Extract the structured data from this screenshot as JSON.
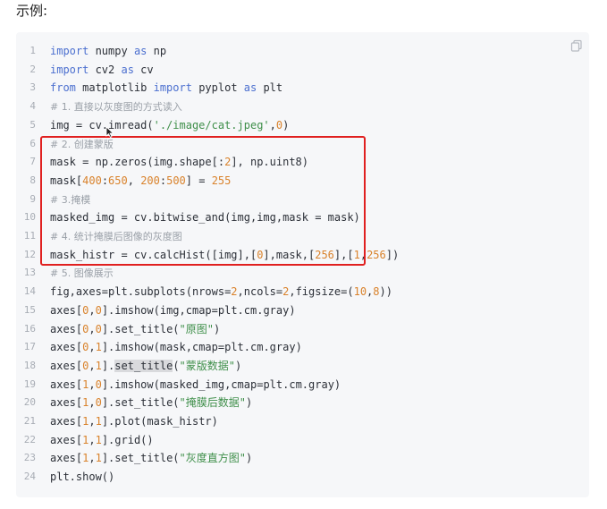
{
  "heading": "示例:",
  "code_block": {
    "copy_icon": "copy-icon",
    "lines": [
      {
        "n": "1",
        "parts": [
          [
            "kw",
            "import"
          ],
          [
            "t",
            " numpy "
          ],
          [
            "kw",
            "as"
          ],
          [
            "t",
            " np"
          ]
        ]
      },
      {
        "n": "2",
        "parts": [
          [
            "kw",
            "import"
          ],
          [
            "t",
            " cv2 "
          ],
          [
            "kw",
            "as"
          ],
          [
            "t",
            " cv"
          ]
        ]
      },
      {
        "n": "3",
        "parts": [
          [
            "kw",
            "from"
          ],
          [
            "t",
            " matplotlib "
          ],
          [
            "kw",
            "import"
          ],
          [
            "t",
            " pyplot "
          ],
          [
            "kw",
            "as"
          ],
          [
            "t",
            " plt"
          ]
        ]
      },
      {
        "n": "4",
        "parts": [
          [
            "cm",
            "# 1. 直接以灰度图的方式读入"
          ]
        ]
      },
      {
        "n": "5",
        "parts": [
          [
            "t",
            "img = cv.imread("
          ],
          [
            "str",
            "'./image/cat.jpeg'"
          ],
          [
            "t",
            ","
          ],
          [
            "num",
            "0"
          ],
          [
            "t",
            ")"
          ]
        ]
      },
      {
        "n": "6",
        "parts": [
          [
            "cm",
            "# 2. 创建蒙版"
          ]
        ]
      },
      {
        "n": "7",
        "parts": [
          [
            "t",
            "mask = np.zeros(img.shape[:"
          ],
          [
            "num",
            "2"
          ],
          [
            "t",
            "], np.uint8)"
          ]
        ]
      },
      {
        "n": "8",
        "parts": [
          [
            "t",
            "mask["
          ],
          [
            "num",
            "400"
          ],
          [
            "t",
            ":"
          ],
          [
            "num",
            "650"
          ],
          [
            "t",
            ", "
          ],
          [
            "num",
            "200"
          ],
          [
            "t",
            ":"
          ],
          [
            "num",
            "500"
          ],
          [
            "t",
            "] = "
          ],
          [
            "num",
            "255"
          ]
        ]
      },
      {
        "n": "9",
        "parts": [
          [
            "cm",
            "# 3.掩模"
          ]
        ]
      },
      {
        "n": "10",
        "parts": [
          [
            "t",
            "masked_img = cv.bitwise_and(img,img,mask = mask)"
          ]
        ]
      },
      {
        "n": "11",
        "parts": [
          [
            "cm",
            "# 4. 统计掩膜后图像的灰度图"
          ]
        ]
      },
      {
        "n": "12",
        "parts": [
          [
            "t",
            "mask_histr = cv.calcHist([img],["
          ],
          [
            "num",
            "0"
          ],
          [
            "t",
            "],mask,["
          ],
          [
            "num",
            "256"
          ],
          [
            "t",
            "],["
          ],
          [
            "num",
            "1"
          ],
          [
            "t",
            ","
          ],
          [
            "num",
            "256"
          ],
          [
            "t",
            "])"
          ]
        ]
      },
      {
        "n": "13",
        "parts": [
          [
            "cm",
            "# 5. 图像展示"
          ]
        ]
      },
      {
        "n": "14",
        "parts": [
          [
            "t",
            "fig,axes=plt.subplots(nrows="
          ],
          [
            "num",
            "2"
          ],
          [
            "t",
            ",ncols="
          ],
          [
            "num",
            "2"
          ],
          [
            "t",
            ",figsize=("
          ],
          [
            "num",
            "10"
          ],
          [
            "t",
            ","
          ],
          [
            "num",
            "8"
          ],
          [
            "t",
            "))"
          ]
        ]
      },
      {
        "n": "15",
        "parts": [
          [
            "t",
            "axes["
          ],
          [
            "num",
            "0"
          ],
          [
            "t",
            ","
          ],
          [
            "num",
            "0"
          ],
          [
            "t",
            "].imshow(img,cmap=plt.cm.gray)"
          ]
        ]
      },
      {
        "n": "16",
        "parts": [
          [
            "t",
            "axes["
          ],
          [
            "num",
            "0"
          ],
          [
            "t",
            ","
          ],
          [
            "num",
            "0"
          ],
          [
            "t",
            "].set_title("
          ],
          [
            "str",
            "\"原图\""
          ],
          [
            "t",
            ")"
          ]
        ]
      },
      {
        "n": "17",
        "parts": [
          [
            "t",
            "axes["
          ],
          [
            "num",
            "0"
          ],
          [
            "t",
            ","
          ],
          [
            "num",
            "1"
          ],
          [
            "t",
            "].imshow(mask,cmap=plt.cm.gray)"
          ]
        ]
      },
      {
        "n": "18",
        "parts": [
          [
            "t",
            "axes["
          ],
          [
            "num",
            "0"
          ],
          [
            "t",
            ","
          ],
          [
            "num",
            "1"
          ],
          [
            "t",
            "]."
          ],
          [
            "sel",
            "set_title"
          ],
          [
            "t",
            "("
          ],
          [
            "str",
            "\"蒙版数据\""
          ],
          [
            "t",
            ")"
          ]
        ]
      },
      {
        "n": "19",
        "parts": [
          [
            "t",
            "axes["
          ],
          [
            "num",
            "1"
          ],
          [
            "t",
            ","
          ],
          [
            "num",
            "0"
          ],
          [
            "t",
            "].imshow(masked_img,cmap=plt.cm.gray)"
          ]
        ]
      },
      {
        "n": "20",
        "parts": [
          [
            "t",
            "axes["
          ],
          [
            "num",
            "1"
          ],
          [
            "t",
            ","
          ],
          [
            "num",
            "0"
          ],
          [
            "t",
            "].set_title("
          ],
          [
            "str",
            "\"掩膜后数据\""
          ],
          [
            "t",
            ")"
          ]
        ]
      },
      {
        "n": "21",
        "parts": [
          [
            "t",
            "axes["
          ],
          [
            "num",
            "1"
          ],
          [
            "t",
            ","
          ],
          [
            "num",
            "1"
          ],
          [
            "t",
            "].plot(mask_histr)"
          ]
        ]
      },
      {
        "n": "22",
        "parts": [
          [
            "t",
            "axes["
          ],
          [
            "num",
            "1"
          ],
          [
            "t",
            ","
          ],
          [
            "num",
            "1"
          ],
          [
            "t",
            "].grid()"
          ]
        ]
      },
      {
        "n": "23",
        "parts": [
          [
            "t",
            "axes["
          ],
          [
            "num",
            "1"
          ],
          [
            "t",
            ","
          ],
          [
            "num",
            "1"
          ],
          [
            "t",
            "].set_title("
          ],
          [
            "str",
            "\"灰度直方图\""
          ],
          [
            "t",
            ")"
          ]
        ]
      },
      {
        "n": "24",
        "parts": [
          [
            "t",
            "plt.show()"
          ]
        ]
      }
    ]
  },
  "highlight_color": "#e02020"
}
